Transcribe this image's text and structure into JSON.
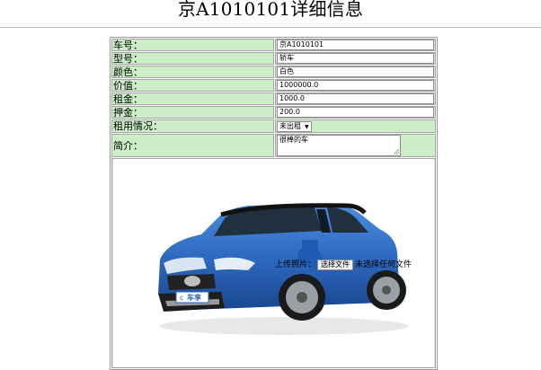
{
  "page": {
    "title": "京A1010101详细信息"
  },
  "form": {
    "rows": [
      {
        "label": "车号：",
        "value": "京A1010101"
      },
      {
        "label": "型号：",
        "value": "轿车"
      },
      {
        "label": "颜色：",
        "value": "白色"
      },
      {
        "label": "价值：",
        "value": "1000000.0"
      },
      {
        "label": "租金：",
        "value": "1000.0"
      },
      {
        "label": "押金：",
        "value": "200.0"
      }
    ],
    "rent_status": {
      "label": "租用情况：",
      "selected": "未出租"
    },
    "description": {
      "label": "简介：",
      "value": "很棒的车"
    },
    "upload": {
      "label": "上传照片：",
      "button": "选择文件",
      "status": "未选择任何文件"
    },
    "car_logo_text": "车享"
  },
  "colors": {
    "cell_bg": "#cbeec7",
    "car_body": "#2f6fc6"
  }
}
